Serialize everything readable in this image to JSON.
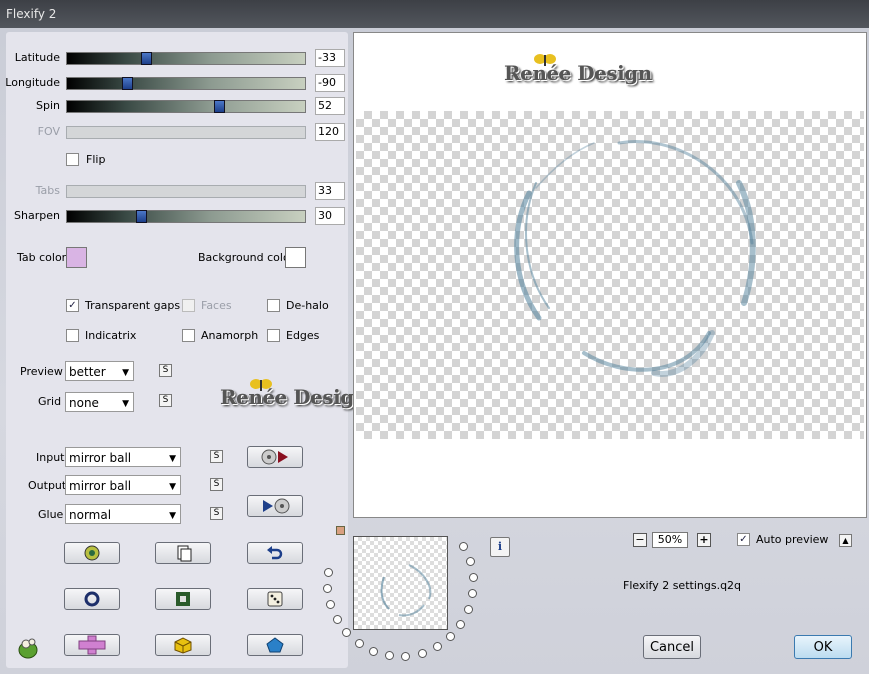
{
  "window": {
    "title": "Flexify 2"
  },
  "sliders": [
    {
      "label": "Latitude",
      "value": "-33",
      "position": 0.33,
      "enabled": true
    },
    {
      "label": "Longitude",
      "value": "-90",
      "position": 0.25,
      "enabled": true
    },
    {
      "label": "Spin",
      "value": "52",
      "position": 0.64,
      "enabled": true
    },
    {
      "label": "FOV",
      "value": "120",
      "position": 1.0,
      "enabled": false
    },
    {
      "label": "Tabs",
      "value": "33",
      "position": 0.33,
      "enabled": false
    },
    {
      "label": "Sharpen",
      "value": "30",
      "position": 0.31,
      "enabled": true
    }
  ],
  "flip": {
    "label": "Flip",
    "checked": false
  },
  "colors": {
    "tab_label": "Tab color",
    "tab_color": "#d9b4e4",
    "background_label": "Background color",
    "background_color": "#ffffff"
  },
  "options": {
    "transparent_gaps": {
      "label": "Transparent gaps",
      "checked": true
    },
    "faces": {
      "label": "Faces",
      "checked": false
    },
    "de_halo": {
      "label": "De-halo",
      "checked": false
    },
    "indicatrix": {
      "label": "Indicatrix",
      "checked": false
    },
    "anamorph": {
      "label": "Anamorph",
      "checked": false
    },
    "edges": {
      "label": "Edges",
      "checked": false
    }
  },
  "preview_select": {
    "label": "Preview",
    "value": "better"
  },
  "grid_select": {
    "label": "Grid",
    "value": "none"
  },
  "input_select": {
    "label": "Input",
    "value": "mirror ball"
  },
  "output_select": {
    "label": "Output",
    "value": "mirror ball"
  },
  "glue_select": {
    "label": "Glue",
    "value": "normal"
  },
  "s_marker": "S",
  "watermark": "Renée Design",
  "zoom": {
    "value": "50%",
    "minus": "−",
    "plus": "+"
  },
  "auto_preview": {
    "label": "Auto preview",
    "checked": true
  },
  "info_glyph": "i",
  "settings_file": "Flexify 2 settings.q2q",
  "buttons": {
    "cancel": "Cancel",
    "ok": "OK"
  },
  "icons": [
    "random-icon",
    "copy-icon",
    "undo-icon",
    "ring-icon",
    "square-icon",
    "dice-icon",
    "plus-shape-icon",
    "cube-icon",
    "pentagon-icon",
    "in-disc-icon",
    "out-disc-icon",
    "app-logo-icon"
  ],
  "accent_color": "#1d3f8a"
}
